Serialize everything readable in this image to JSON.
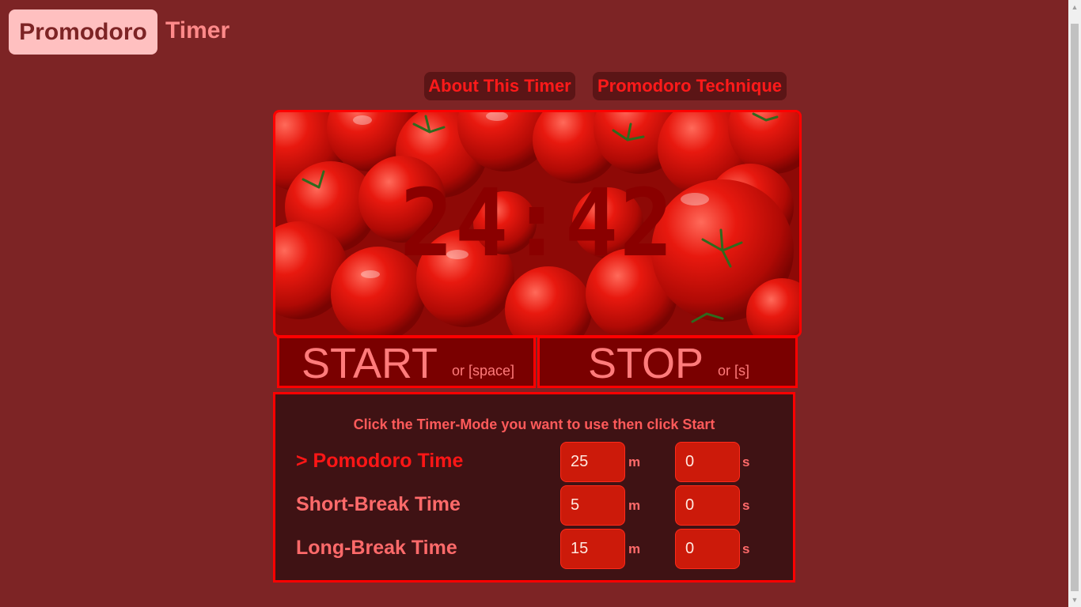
{
  "header": {
    "brand_highlight": "Promodoro",
    "brand_rest": "Timer"
  },
  "nav": {
    "about_label": "About This Timer",
    "technique_label": "Promodoro Technique"
  },
  "timer": {
    "display": "24:42",
    "background_image": "tomatoes"
  },
  "controls": {
    "start_label": "START",
    "start_hint": "or [space]",
    "stop_label": "STOP",
    "stop_hint": "or [s]"
  },
  "modes": {
    "instruction": "Click the Timer-Mode you want to use then click Start",
    "rows": [
      {
        "label": "> Pomodoro Time",
        "minutes": "25",
        "seconds": "0",
        "active": true
      },
      {
        "label": "Short-Break Time",
        "minutes": "5",
        "seconds": "0",
        "active": false
      },
      {
        "label": "Long-Break Time",
        "minutes": "15",
        "seconds": "0",
        "active": false
      }
    ],
    "minute_unit": "m",
    "second_unit": "s"
  },
  "colors": {
    "page_bg": "#7d2425",
    "accent_red": "#ff0000",
    "brand_box": "#ffc0c0"
  }
}
